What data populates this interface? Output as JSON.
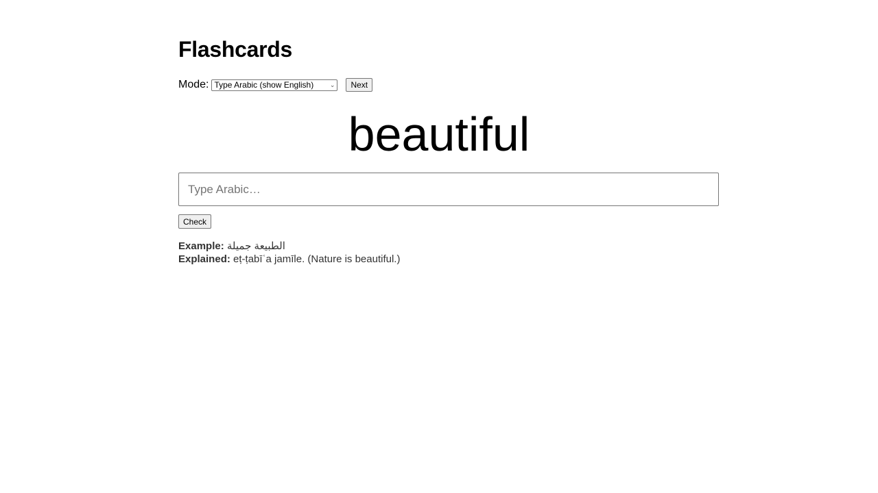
{
  "title": "Flashcards",
  "mode": {
    "label": "Mode:",
    "selected": "Type Arabic (show English)"
  },
  "next_label": "Next",
  "card_word": "beautiful",
  "answer": {
    "placeholder": "Type Arabic…",
    "value": ""
  },
  "check_label": "Check",
  "example": {
    "label": "Example:",
    "text": "الطبيعة جميلة"
  },
  "explained": {
    "label": "Explained:",
    "text": "eṭ-ṭabīʿa jamīle. (Nature is beautiful.)"
  }
}
